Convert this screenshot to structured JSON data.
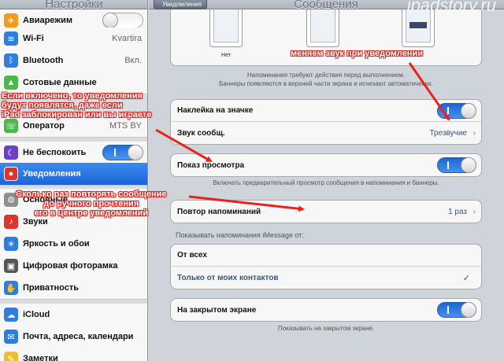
{
  "sidebar": {
    "title": "Настройки",
    "items": [
      {
        "label": "Авиарежим",
        "icon": "airplane-icon",
        "color": "#f29b1d",
        "toggle": "off"
      },
      {
        "label": "Wi-Fi",
        "icon": "wifi-icon",
        "color": "#2f7de1",
        "value": "Kvartira"
      },
      {
        "label": "Bluetooth",
        "icon": "bluetooth-icon",
        "color": "#2f7de1",
        "value": "Вкл."
      },
      {
        "label": "Сотовые данные",
        "icon": "cellular-icon",
        "color": "#4cb84c"
      },
      {
        "label": "Оператор",
        "icon": "carrier-icon",
        "color": "#4cb84c",
        "value": "MTS BY"
      },
      {
        "label": "Не беспокоить",
        "icon": "moon-icon",
        "color": "#6a3fc9",
        "toggle": "on"
      },
      {
        "label": "Уведомления",
        "icon": "notifications-icon",
        "color": "#e0332b",
        "selected": true
      },
      {
        "label": "Основные",
        "icon": "gear-icon",
        "color": "#8e8e93"
      },
      {
        "label": "Звуки",
        "icon": "speaker-icon",
        "color": "#e0332b"
      },
      {
        "label": "Яркость и обои",
        "icon": "sun-icon",
        "color": "#2f7de1"
      },
      {
        "label": "Цифровая фоторамка",
        "icon": "picture-frame-icon",
        "color": "#555555"
      },
      {
        "label": "Приватность",
        "icon": "hand-icon",
        "color": "#2f7de1"
      },
      {
        "label": "iCloud",
        "icon": "cloud-icon",
        "color": "#2f7de1"
      },
      {
        "label": "Почта, адреса, календари",
        "icon": "mail-icon",
        "color": "#2f7de1"
      },
      {
        "label": "Заметки",
        "icon": "notes-icon",
        "color": "#e8c22a"
      }
    ]
  },
  "main": {
    "back_label": "Уведомления",
    "title": "Сообщения",
    "watermark": "ipadstory.ru",
    "alert_styles": [
      "Нет",
      "",
      ""
    ],
    "alert_footnote": "Напоминания требуют действия перед выполнением.\nБаннеры появляются в верхней части экрана и исчезают автоматически.",
    "badge_label": "Наклейка на значке",
    "sound_label": "Звук сообщ.",
    "sound_value": "Трезвучие",
    "preview_label": "Показ просмотра",
    "preview_footnote": "Включать предварительный просмотр сообщения в напоминания и баннеры.",
    "repeat_label": "Повтор напоминаний",
    "repeat_value": "1 раз",
    "imessage_header": "Показывать напоминания iMessage от:",
    "from_all": "От всех",
    "from_contacts": "Только от моих контактов",
    "lock_label": "На закрытом экране",
    "lock_footnote": "Показывать на закрытом экране."
  },
  "annotations": {
    "sound": "меняем звук при уведомлении",
    "badge": "Если включено, то уведомления\nбудут появлятся, даже если\niPad заблокирован или вы играете",
    "repeat": "Сколько раз повторять сообщение\nдо ручного прочтения\nего в центре уведомлений"
  },
  "colors": {
    "accent": "#1b64d9",
    "annotation": "#d8201a"
  }
}
